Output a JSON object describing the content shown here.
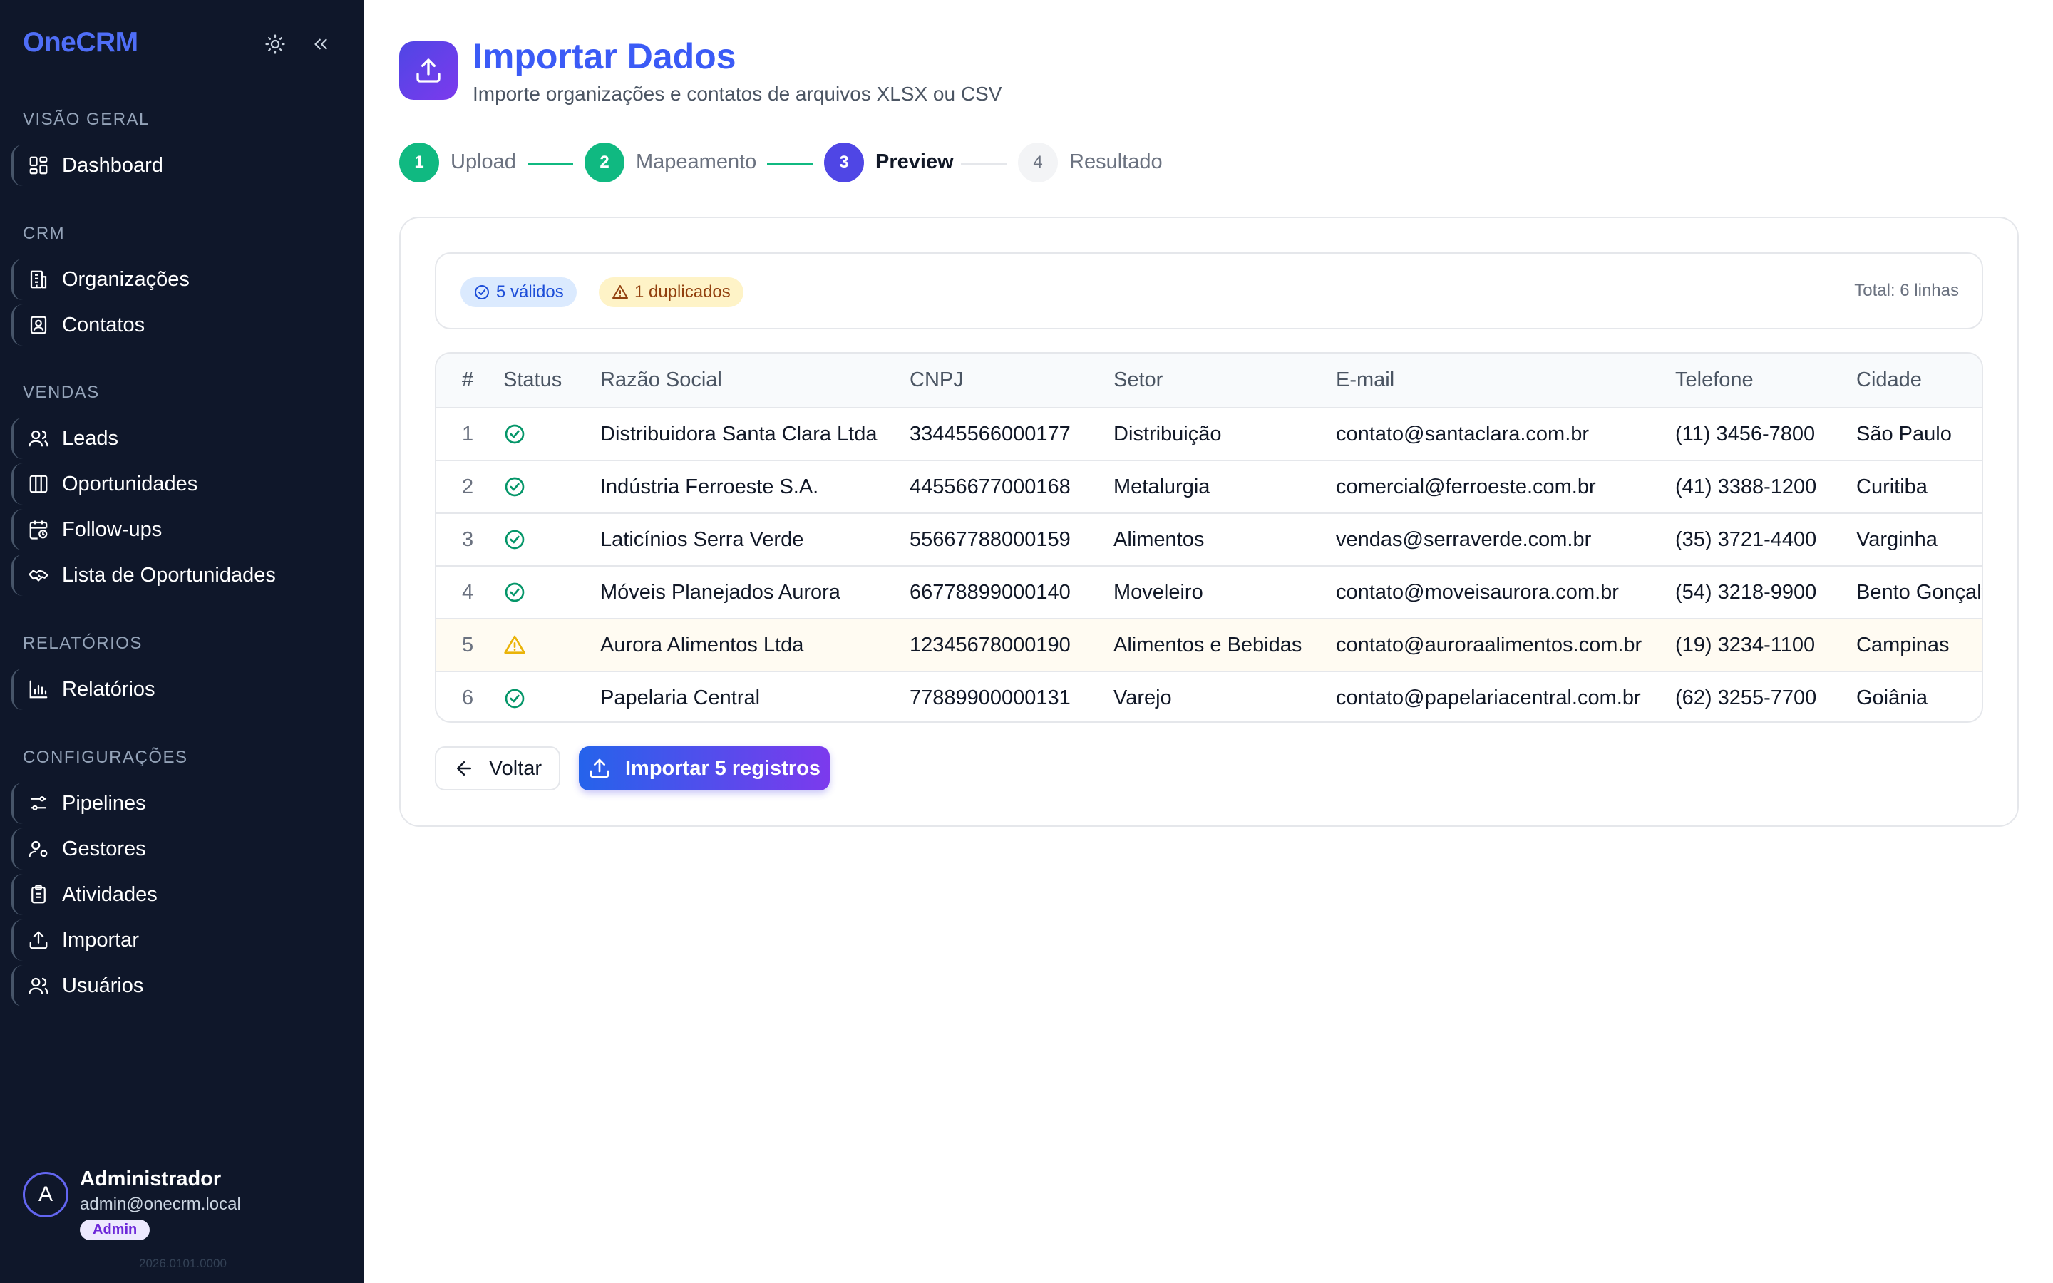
{
  "sidebar": {
    "brand": "OneCRM",
    "sections": [
      {
        "label": "VISÃO GERAL",
        "items": [
          {
            "label": "Dashboard",
            "icon": "dashboard-icon"
          }
        ]
      },
      {
        "label": "CRM",
        "items": [
          {
            "label": "Organizações",
            "icon": "building-icon"
          },
          {
            "label": "Contatos",
            "icon": "contact-icon"
          }
        ]
      },
      {
        "label": "VENDAS",
        "items": [
          {
            "label": "Leads",
            "icon": "users-icon"
          },
          {
            "label": "Oportunidades",
            "icon": "kanban-icon"
          },
          {
            "label": "Follow-ups",
            "icon": "calendar-clock-icon"
          },
          {
            "label": "Lista de Oportunidades",
            "icon": "handshake-icon"
          }
        ]
      },
      {
        "label": "RELATÓRIOS",
        "items": [
          {
            "label": "Relatórios",
            "icon": "bar-chart-icon"
          }
        ]
      },
      {
        "label": "CONFIGURAÇÕES",
        "items": [
          {
            "label": "Pipelines",
            "icon": "sliders-icon"
          },
          {
            "label": "Gestores",
            "icon": "user-cog-icon"
          },
          {
            "label": "Atividades",
            "icon": "clipboard-icon"
          },
          {
            "label": "Importar",
            "icon": "upload-icon"
          },
          {
            "label": "Usuários",
            "icon": "users-icon"
          }
        ]
      }
    ],
    "user": {
      "initial": "A",
      "name": "Administrador",
      "email": "admin@onecrm.local",
      "role": "Admin"
    },
    "version": "2026.0101.0000"
  },
  "header": {
    "title": "Importar Dados",
    "subtitle": "Importe organizações e contatos de arquivos XLSX ou CSV"
  },
  "stepper": {
    "steps": [
      {
        "number": "1",
        "label": "Upload",
        "state": "done"
      },
      {
        "number": "2",
        "label": "Mapeamento",
        "state": "done"
      },
      {
        "number": "3",
        "label": "Preview",
        "state": "active"
      },
      {
        "number": "4",
        "label": "Resultado",
        "state": "pending"
      }
    ]
  },
  "summary": {
    "valid": "5 válidos",
    "duplicates": "1 duplicados",
    "total": "Total: 6 linhas"
  },
  "table": {
    "columns": [
      "#",
      "Status",
      "Razão Social",
      "CNPJ",
      "Setor",
      "E-mail",
      "Telefone",
      "Cidade"
    ],
    "rows": [
      {
        "n": "1",
        "status": "valid",
        "razao": "Distribuidora Santa Clara Ltda",
        "cnpj": "33445566000177",
        "setor": "Distribuição",
        "email": "contato@santaclara.com.br",
        "telefone": "(11) 3456-7800",
        "cidade": "São Paulo"
      },
      {
        "n": "2",
        "status": "valid",
        "razao": "Indústria Ferroeste S.A.",
        "cnpj": "44556677000168",
        "setor": "Metalurgia",
        "email": "comercial@ferroeste.com.br",
        "telefone": "(41) 3388-1200",
        "cidade": "Curitiba"
      },
      {
        "n": "3",
        "status": "valid",
        "razao": "Laticínios Serra Verde",
        "cnpj": "55667788000159",
        "setor": "Alimentos",
        "email": "vendas@serraverde.com.br",
        "telefone": "(35) 3721-4400",
        "cidade": "Varginha"
      },
      {
        "n": "4",
        "status": "valid",
        "razao": "Móveis Planejados Aurora",
        "cnpj": "66778899000140",
        "setor": "Moveleiro",
        "email": "contato@moveisaurora.com.br",
        "telefone": "(54) 3218-9900",
        "cidade": "Bento Gonçalves"
      },
      {
        "n": "5",
        "status": "duplicate",
        "razao": "Aurora Alimentos Ltda",
        "cnpj": "12345678000190",
        "setor": "Alimentos e Bebidas",
        "email": "contato@auroraalimentos.com.br",
        "telefone": "(19) 3234-1100",
        "cidade": "Campinas"
      },
      {
        "n": "6",
        "status": "valid",
        "razao": "Papelaria Central",
        "cnpj": "77889900000131",
        "setor": "Varejo",
        "email": "contato@papelariacentral.com.br",
        "telefone": "(62) 3255-7700",
        "cidade": "Goiânia"
      }
    ]
  },
  "actions": {
    "back": "Voltar",
    "import": "Importar 5 registros"
  },
  "colors": {
    "sidebar_bg": "#0f172a",
    "brand": "#4f6ef7",
    "step_done": "#10b981",
    "step_active": "#4f46e5",
    "valid": "#059669",
    "warning": "#eab308"
  }
}
